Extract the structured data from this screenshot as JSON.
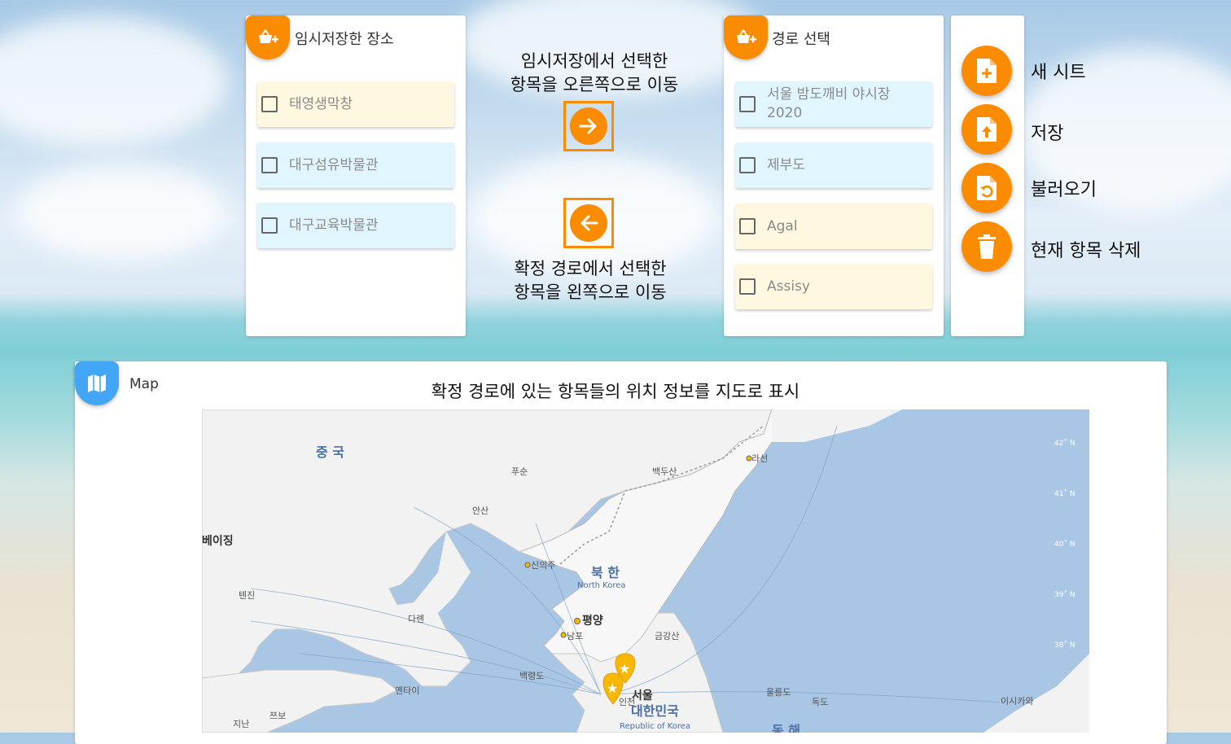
{
  "temp_panel": {
    "title": "임시저장한 장소",
    "icon": "basket-add-icon",
    "items": [
      {
        "label": "태영생막창",
        "color": "yellow"
      },
      {
        "label": "대구섬유박물관",
        "color": "blue"
      },
      {
        "label": "대구교육박물관",
        "color": "blue"
      }
    ]
  },
  "middle": {
    "move_right_line1": "임시저장에서 선택한",
    "move_right_line2": "항목을 오른쪽으로 이동",
    "move_left_line1": "확정 경로에서 선택한",
    "move_left_line2": "항목을 왼쪽으로 이동",
    "right_icon": "arrow-right-icon",
    "left_icon": "arrow-left-icon"
  },
  "route_panel": {
    "title": "경로 선택",
    "icon": "basket-add-icon",
    "items": [
      {
        "label_line1": "서울 밤도깨비 야시장",
        "label_line2": "2020",
        "color": "blue"
      },
      {
        "label": "제부도",
        "color": "blue"
      },
      {
        "label": "Agal",
        "color": "yellow"
      },
      {
        "label": "Assisy",
        "color": "yellow"
      }
    ]
  },
  "actions": [
    {
      "label": "새 시트",
      "icon": "new-file-icon"
    },
    {
      "label": "저장",
      "icon": "file-upload-icon"
    },
    {
      "label": "불러오기",
      "icon": "file-restore-icon"
    },
    {
      "label": "현재 항목 삭제",
      "icon": "trash-icon"
    }
  ],
  "map_panel": {
    "title": "Map",
    "icon": "map-icon",
    "heading": "확정 경로에 있는 항목들의 위치 정보를 지도로 표시",
    "labels": {
      "china": "중 국",
      "beijing": "베이징",
      "tianjin": "톈진",
      "fushun": "푸순",
      "anshan": "안산",
      "dalian": "다롄",
      "yantai": "옌타이",
      "jinan": "지난",
      "zibo": "쯔보",
      "baekdu": "백두산",
      "rason": "라선",
      "sinuiju": "신의주",
      "north_korea": "북 한",
      "north_korea_en": "North Korea",
      "pyongyang": "평양",
      "nampo": "남포",
      "geumgang": "금강산",
      "baengnyeong": "백령도",
      "seoul": "서울",
      "incheon": "인천",
      "south_korea": "대한민국",
      "south_korea_en": "Republic of Korea",
      "ulleung": "울릉도",
      "dokdo": "독도",
      "ishikawa": "이시카와",
      "east_sea": "동 해",
      "lat42": "42˚ N",
      "lat41": "41˚ N",
      "lat40": "40˚ N",
      "lat39": "39˚ N",
      "lat38": "38˚ N"
    }
  },
  "colors": {
    "accent": "#fb8c00",
    "map_badge": "#42a5f5",
    "item_yellow": "#fff8e1",
    "item_blue": "#e1f5fe",
    "sea": "#a9c6e4",
    "land": "#f2f2f2",
    "marker": "#f9b800"
  }
}
